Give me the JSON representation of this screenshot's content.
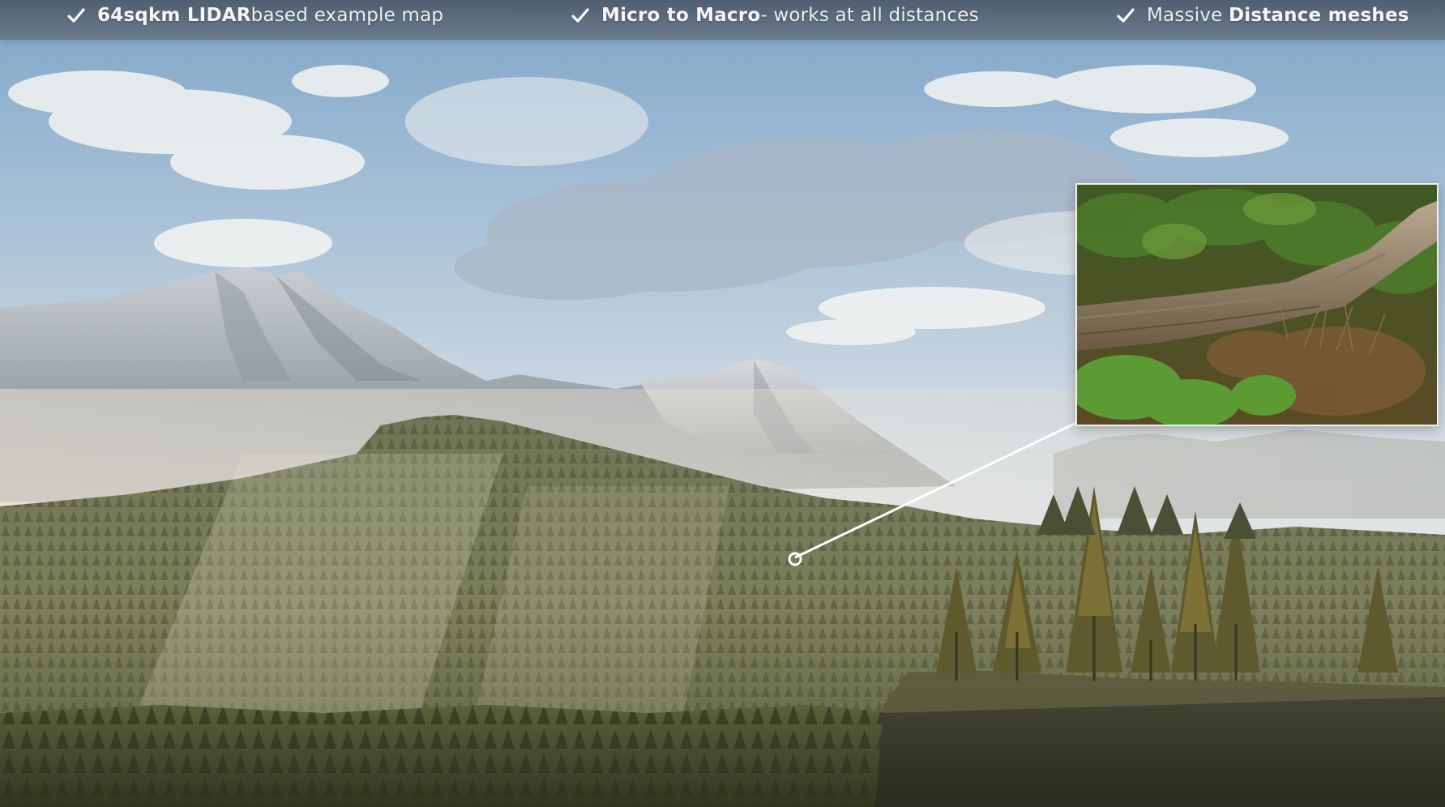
{
  "features": [
    {
      "icon": "check-icon",
      "bold1": "64sqkm LIDAR",
      "text1": " based example map",
      "bold2": "",
      "text2": ""
    },
    {
      "icon": "check-icon",
      "bold1": "Micro to Macro",
      "text1": " - works at all distances",
      "bold2": "",
      "text2": ""
    },
    {
      "icon": "check-icon",
      "bold1": "",
      "text1": "Massive ",
      "bold2": "Distance meshes",
      "text2": ""
    }
  ],
  "colors": {
    "sky_top": "#8fb3d2",
    "sky_bottom": "#d9e1e6",
    "forest_dark": "#3e4a2c",
    "forest_light": "#8a8f62",
    "bar": "#5a6572"
  }
}
